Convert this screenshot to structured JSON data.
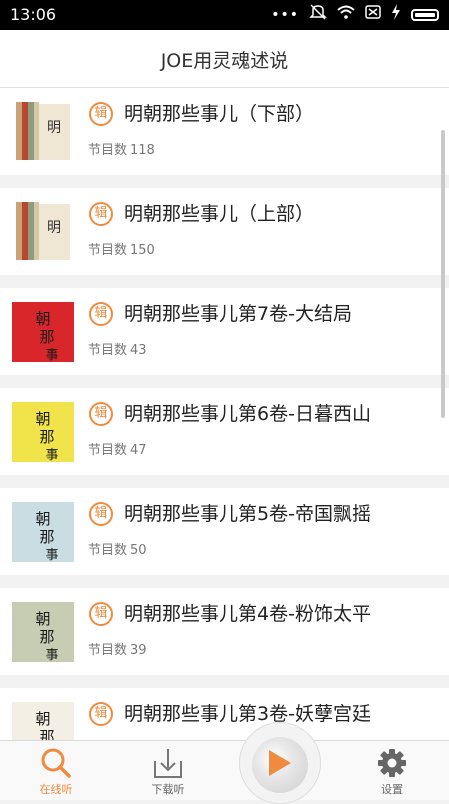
{
  "status_bar": {
    "time": "13:06"
  },
  "header": {
    "title": "JOE用灵魂述说"
  },
  "albums": [
    {
      "badge": "辑",
      "title": "明朝那些事儿（下部）",
      "count_label": "节目数",
      "count": "118"
    },
    {
      "badge": "辑",
      "title": "明朝那些事儿（上部）",
      "count_label": "节目数",
      "count": "150"
    },
    {
      "badge": "辑",
      "title": "明朝那些事儿第7卷-大结局",
      "count_label": "节目数",
      "count": "43"
    },
    {
      "badge": "辑",
      "title": "明朝那些事儿第6卷-日暮西山",
      "count_label": "节目数",
      "count": "47"
    },
    {
      "badge": "辑",
      "title": "明朝那些事儿第5卷-帝国飘摇",
      "count_label": "节目数",
      "count": "50"
    },
    {
      "badge": "辑",
      "title": "明朝那些事儿第4卷-粉饰太平",
      "count_label": "节目数",
      "count": "39"
    },
    {
      "badge": "辑",
      "title": "明朝那些事儿第3卷-妖孽宫廷",
      "count_label": "",
      "count": ""
    }
  ],
  "tabs": [
    {
      "label": "在线听",
      "icon": "search-icon",
      "active": true
    },
    {
      "label": "下载听",
      "icon": "download-icon",
      "active": false
    },
    {
      "label": "",
      "icon": "play-icon",
      "active": false
    },
    {
      "label": "设置",
      "icon": "gear-icon",
      "active": false
    }
  ],
  "colors": {
    "accent": "#f08a3e",
    "status_bar": "#000000",
    "background": "#f2f2f2"
  }
}
